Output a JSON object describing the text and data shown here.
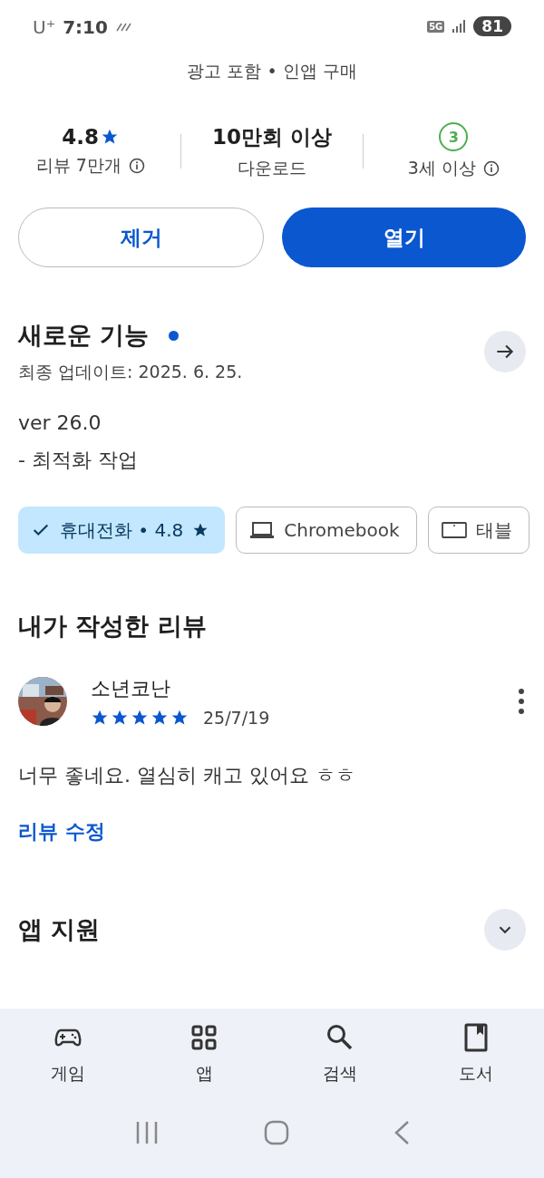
{
  "status_bar": {
    "carrier": "U⁺",
    "time": "7:10",
    "network": "5G",
    "battery": "81"
  },
  "app_info": {
    "tags": "광고 포함 • 인앱 구매"
  },
  "stats": [
    {
      "kind": "rating",
      "value": "4.8",
      "label": "리뷰 7만개",
      "info": true
    },
    {
      "kind": "text",
      "value": "10만회 이상",
      "label": "다운로드",
      "info": false
    },
    {
      "kind": "age",
      "value": "3",
      "label": "3세 이상",
      "info": true
    }
  ],
  "buttons": [
    {
      "label": "제거",
      "kind": "outline"
    },
    {
      "label": "열기",
      "kind": "filled"
    }
  ],
  "whats_new": {
    "title": "새로운 기능",
    "unread": true,
    "updated": "최종 업데이트: 2025. 6. 25.",
    "version": "ver 26.0",
    "notes": "- 최적화 작업"
  },
  "device_chips": [
    {
      "kind": "phone",
      "label": "휴대전화 • 4.8",
      "rated": true,
      "selected": true
    },
    {
      "kind": "laptop",
      "label": "Chromebook",
      "rated": false,
      "selected": false
    },
    {
      "kind": "tablet",
      "label": "태블",
      "rated": false,
      "selected": false
    }
  ],
  "my_review": {
    "title": "내가 작성한 리뷰",
    "author": "소년코난",
    "stars": 5,
    "date": "25/7/19",
    "text": "너무 좋네요. 열심히 캐고 있어요 ㅎㅎ",
    "edit_link": "리뷰 수정"
  },
  "app_support": {
    "title": "앱 지원",
    "expanded": false
  },
  "bottom_nav": [
    {
      "kind": "games",
      "label": "게임"
    },
    {
      "kind": "apps",
      "label": "앱"
    },
    {
      "kind": "search",
      "label": "검색"
    },
    {
      "kind": "books",
      "label": "도서"
    }
  ]
}
